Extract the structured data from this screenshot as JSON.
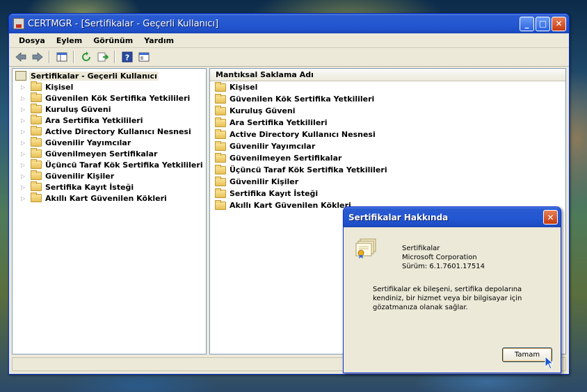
{
  "window": {
    "title": "CERTMGR - [Sertifikalar - Geçerli Kullanıcı]",
    "controls": [
      "_",
      "□",
      "✕"
    ]
  },
  "menu": [
    "Dosya",
    "Eylem",
    "Görünüm",
    "Yardım"
  ],
  "toolbar_icons": [
    "back-arrow-icon",
    "forward-arrow-icon",
    "show-hide-tree-icon",
    "refresh-icon",
    "export-list-icon",
    "help-icon",
    "properties-icon"
  ],
  "tree": {
    "root": "Sertifikalar - Geçerli Kullanıcı",
    "items": [
      "Kişisel",
      "Güvenilen Kök Sertifika Yetkilileri",
      "Kuruluş Güveni",
      "Ara Sertifika Yetkilileri",
      "Active Directory Kullanıcı Nesnesi",
      "Güvenilir Yayımcılar",
      "Güvenilmeyen Sertifikalar",
      "Üçüncü Taraf Kök Sertifika Yetkilileri",
      "Güvenilir Kişiler",
      "Sertifika Kayıt İsteği",
      "Akıllı Kart Güvenilen Kökleri"
    ]
  },
  "list": {
    "header": "Mantıksal Saklama Adı",
    "items": [
      "Kişisel",
      "Güvenilen Kök Sertifika Yetkilileri",
      "Kuruluş Güveni",
      "Ara Sertifika Yetkilileri",
      "Active Directory Kullanıcı Nesnesi",
      "Güvenilir Yayımcılar",
      "Güvenilmeyen Sertifikalar",
      "Üçüncü Taraf Kök Sertifika Yetkilileri",
      "Güvenilir Kişiler",
      "Sertifika Kayıt İsteği",
      "Akıllı Kart Güvenilen Kökleri"
    ]
  },
  "dialog": {
    "title": "Sertifikalar Hakkında",
    "close": "✕",
    "product": "Sertifikalar",
    "company": "Microsoft Corporation",
    "version": "Sürüm: 6.1.7601.17514",
    "description": "Sertifikalar ek bileşeni, sertifika depolarına kendiniz, bir hizmet veya bir bilgisayar için gözatmanıza olanak sağlar.",
    "ok_label": "Tamam"
  },
  "colors": {
    "titlebar": "#2458d2",
    "window_face": "#ece9d8",
    "close_button": "#c43a10",
    "folder": "#f0cc66"
  }
}
